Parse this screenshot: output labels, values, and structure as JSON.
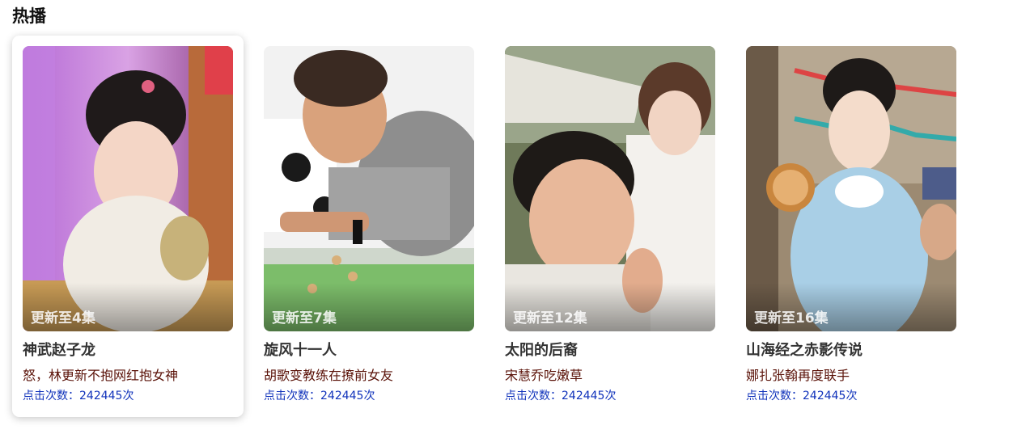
{
  "section": {
    "title": "热播"
  },
  "colors": {
    "accent": "#1133bb",
    "subtitle": "#5a1208",
    "title": "#333333"
  },
  "cards": [
    {
      "title": "神武赵子龙",
      "subtitle": "怒，林更新不抱网红抱女神",
      "badge": "更新至4集",
      "clicks": "点击次数：242445次"
    },
    {
      "title": "旋风十一人",
      "subtitle": "胡歌变教练在撩前女友",
      "badge": "更新至7集",
      "clicks": "点击次数：242445次"
    },
    {
      "title": "太阳的后裔",
      "subtitle": "宋慧乔吃嫩草",
      "badge": "更新至12集",
      "clicks": "点击次数：242445次"
    },
    {
      "title": "山海经之赤影传说",
      "subtitle": "娜扎张翰再度联手",
      "badge": "更新至16集",
      "clicks": "点击次数：242445次"
    }
  ]
}
